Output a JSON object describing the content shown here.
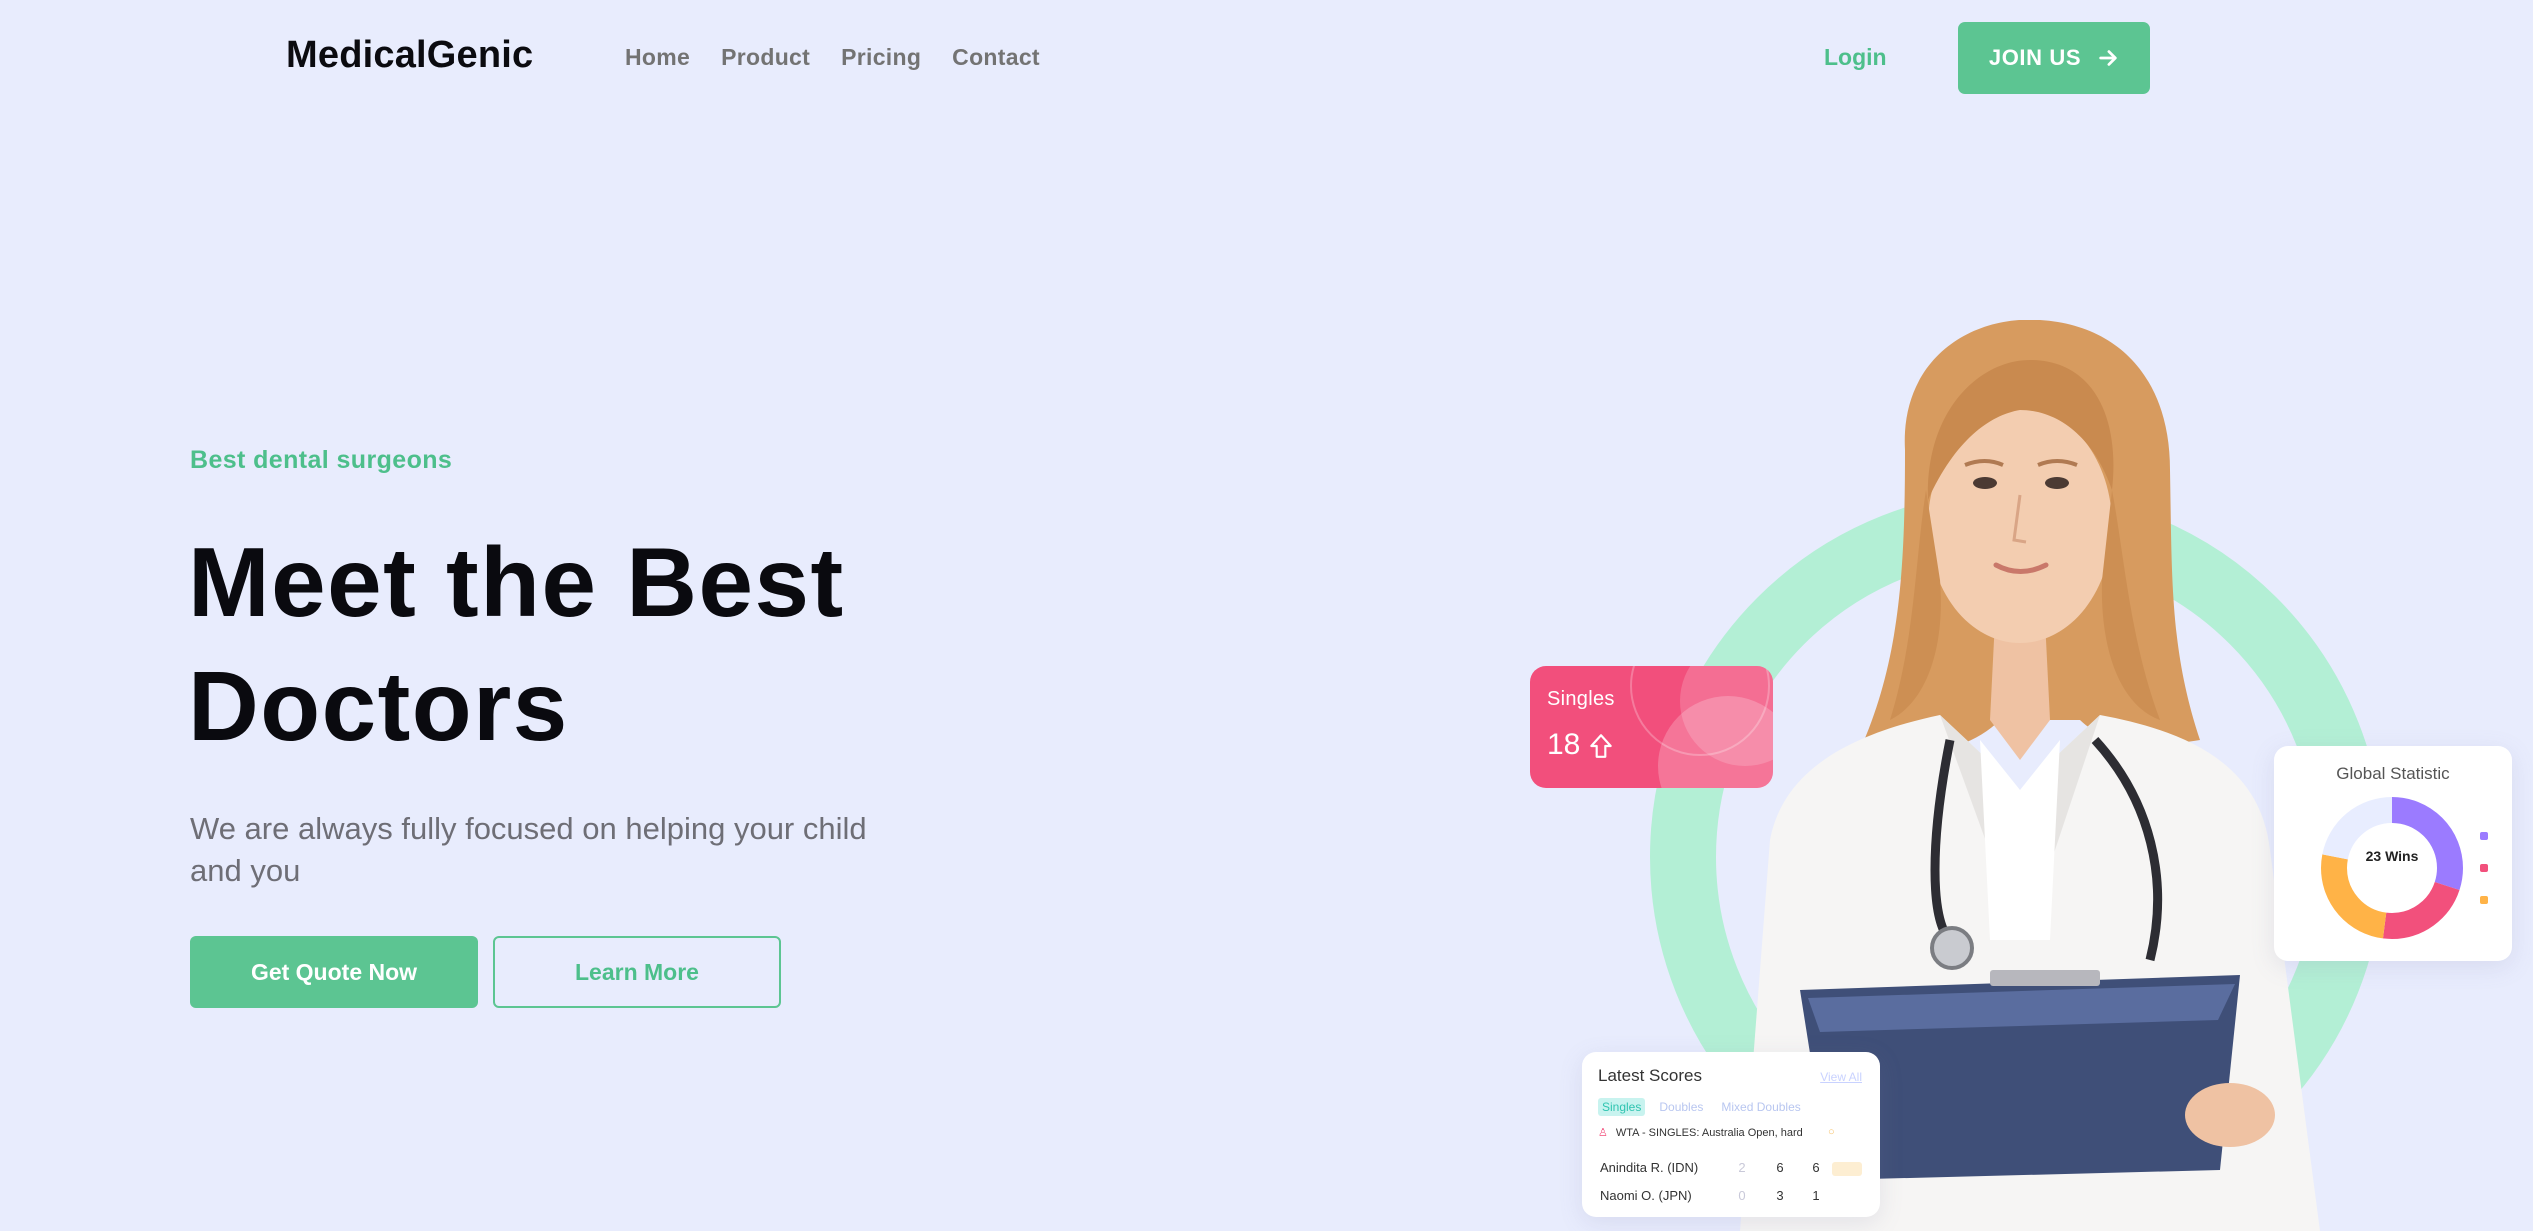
{
  "nav": {
    "brand": "MedicalGenic",
    "links": [
      "Home",
      "Product",
      "Pricing",
      "Contact"
    ],
    "login": "Login",
    "join": "JOIN US"
  },
  "hero": {
    "eyebrow": "Best dental surgeons",
    "title_line1": "Meet the Best",
    "title_line2": "Doctors",
    "subtitle": "We are always fully focused on helping your child and you",
    "primary_cta": "Get Quote Now",
    "secondary_cta": "Learn More"
  },
  "singles_card": {
    "label": "Singles",
    "value": "18",
    "trend_icon": "arrow-up-icon",
    "color": "#f24f7c"
  },
  "global_card": {
    "title": "Global Statistic",
    "center_label": "23 Wins",
    "segments": [
      {
        "color": "#9b7bff",
        "fraction": 0.3
      },
      {
        "color": "#f2507c",
        "fraction": 0.22
      },
      {
        "color": "#ffb347",
        "fraction": 0.26
      },
      {
        "color": "#e8edff",
        "fraction": 0.22
      }
    ]
  },
  "scores_card": {
    "title": "Latest Scores",
    "view_all": "View All",
    "tabs": [
      "Singles",
      "Doubles",
      "Mixed Doubles"
    ],
    "event": "WTA - SINGLES: Australia Open, hard",
    "rows": [
      {
        "name": "Anindita R. (IDN)",
        "s1": "2",
        "s2": "6",
        "s3": "6"
      },
      {
        "name": "Naomi O. (JPN)",
        "s1": "0",
        "s2": "3",
        "s3": "1"
      }
    ]
  },
  "colors": {
    "background": "#e8ecfd",
    "accent": "#5cc592",
    "ring": "#b3efd5"
  }
}
